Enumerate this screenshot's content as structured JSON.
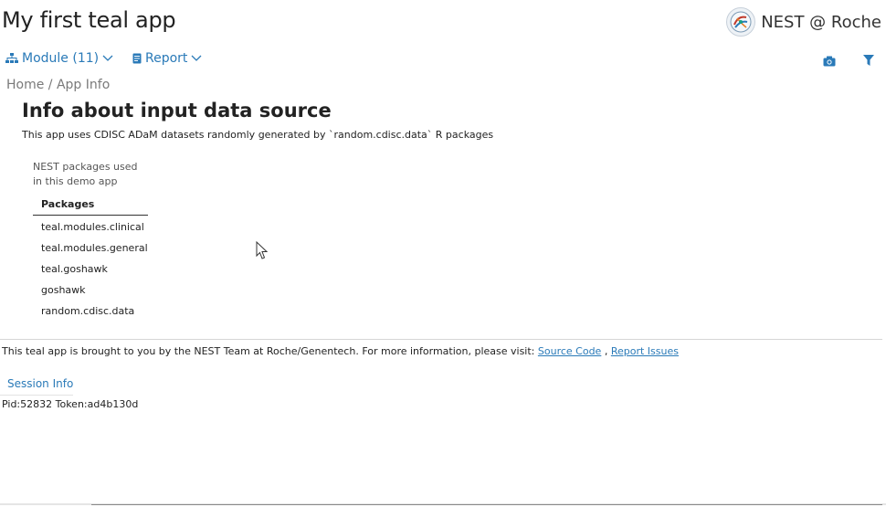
{
  "app": {
    "title": "My first teal app",
    "brand": "NEST @ Roche"
  },
  "nav": {
    "module_label": "Module (11)",
    "report_label": "Report",
    "camera_icon": "camera-icon",
    "filter_icon": "filter-icon"
  },
  "breadcrumb": "Home / App Info",
  "info": {
    "title": "Info about input data source",
    "description": "This app uses CDISC ADaM datasets randomly generated by `random.cdisc.data` R packages"
  },
  "packages_table": {
    "caption": "NEST packages used in this demo app",
    "header": "Packages",
    "rows": [
      "teal.modules.clinical",
      "teal.modules.general",
      "teal.goshawk",
      "goshawk",
      "random.cdisc.data"
    ]
  },
  "footer": {
    "text": "This teal app is brought to you by the NEST Team at Roche/Genentech. For more information, please visit:",
    "source_code_link": "Source Code",
    "separator": ",",
    "report_issues_link": "Report Issues"
  },
  "session": {
    "label": "Session Info",
    "pid_token": "Pid:52832 Token:ad4b130d"
  },
  "colors": {
    "accent": "#2a7ab8",
    "text": "#222222",
    "muted": "#7a7a7a"
  }
}
